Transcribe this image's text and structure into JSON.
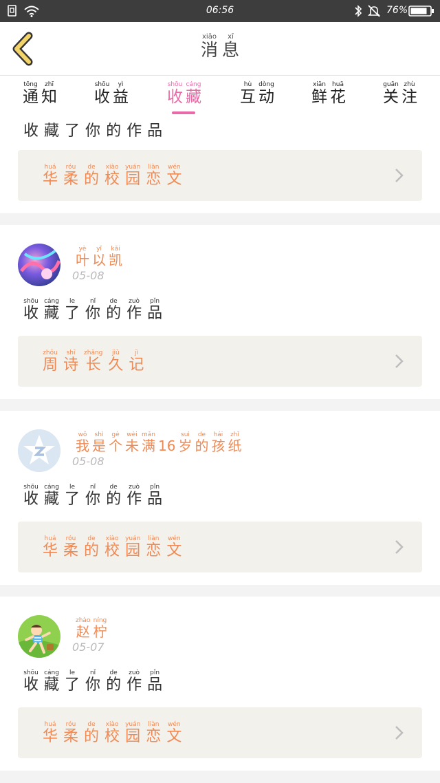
{
  "status_bar": {
    "time": "06:56",
    "battery_percent": "76%"
  },
  "header": {
    "title": [
      {
        "c": "消",
        "p": "xiāo"
      },
      {
        "c": "息",
        "p": "xī"
      }
    ]
  },
  "tabs": [
    {
      "label": [
        {
          "c": "通",
          "p": "tōng"
        },
        {
          "c": "知",
          "p": "zhī"
        }
      ]
    },
    {
      "label": [
        {
          "c": "收",
          "p": "shōu"
        },
        {
          "c": "益",
          "p": "yì"
        }
      ]
    },
    {
      "label": [
        {
          "c": "收",
          "p": "shōu"
        },
        {
          "c": "藏",
          "p": "cáng"
        }
      ],
      "active": true
    },
    {
      "label": [
        {
          "c": "互",
          "p": "hù"
        },
        {
          "c": "动",
          "p": "dòng"
        }
      ]
    },
    {
      "label": [
        {
          "c": "鲜",
          "p": "xiān"
        },
        {
          "c": "花",
          "p": "huā"
        }
      ]
    },
    {
      "label": [
        {
          "c": "关",
          "p": "guān"
        },
        {
          "c": "注",
          "p": "zhù"
        }
      ]
    }
  ],
  "cards": [
    {
      "user": "",
      "date": "",
      "action": [
        {
          "c": "收"
        },
        {
          "c": "藏"
        },
        {
          "c": "了"
        },
        {
          "c": "你"
        },
        {
          "c": "的"
        },
        {
          "c": "作"
        },
        {
          "c": "品"
        }
      ],
      "work": [
        {
          "c": "华",
          "p": "huá"
        },
        {
          "c": "柔",
          "p": "róu"
        },
        {
          "c": "的",
          "p": "de"
        },
        {
          "c": "校",
          "p": "xiào"
        },
        {
          "c": "园",
          "p": "yuán"
        },
        {
          "c": "恋",
          "p": "liàn"
        },
        {
          "c": "文",
          "p": "wén"
        }
      ]
    },
    {
      "user": [
        {
          "c": "叶",
          "p": "yè"
        },
        {
          "c": "以",
          "p": "yǐ"
        },
        {
          "c": "凯",
          "p": "kǎi"
        }
      ],
      "date": "05-08",
      "avatar": "colorful-abstract",
      "action": [
        {
          "c": "收",
          "p": "shōu"
        },
        {
          "c": "藏",
          "p": "cáng"
        },
        {
          "c": "了",
          "p": "le"
        },
        {
          "c": "你",
          "p": "nǐ"
        },
        {
          "c": "的",
          "p": "de"
        },
        {
          "c": "作",
          "p": "zuò"
        },
        {
          "c": "品",
          "p": "pǐn"
        }
      ],
      "work": [
        {
          "c": "周",
          "p": "zhōu"
        },
        {
          "c": "诗",
          "p": "shī"
        },
        {
          "c": "长",
          "p": "zhǎng"
        },
        {
          "c": "久",
          "p": "jiǔ"
        },
        {
          "c": "记",
          "p": "jì"
        }
      ]
    },
    {
      "user": [
        {
          "c": "我",
          "p": "wǒ"
        },
        {
          "c": "是",
          "p": "shì"
        },
        {
          "c": "个",
          "p": "gè"
        },
        {
          "c": "未",
          "p": "wèi"
        },
        {
          "c": "满",
          "p": "mǎn"
        },
        {
          "c": "16",
          "p": ""
        },
        {
          "c": "岁",
          "p": "suì"
        },
        {
          "c": "的",
          "p": "de"
        },
        {
          "c": "孩",
          "p": "hái"
        },
        {
          "c": "纸",
          "p": "zhǐ"
        }
      ],
      "date": "05-08",
      "avatar": "default-star",
      "action": [
        {
          "c": "收",
          "p": "shōu"
        },
        {
          "c": "藏",
          "p": "cáng"
        },
        {
          "c": "了",
          "p": "le"
        },
        {
          "c": "你",
          "p": "nǐ"
        },
        {
          "c": "的",
          "p": "de"
        },
        {
          "c": "作",
          "p": "zuò"
        },
        {
          "c": "品",
          "p": "pǐn"
        }
      ],
      "work": [
        {
          "c": "华",
          "p": "huá"
        },
        {
          "c": "柔",
          "p": "róu"
        },
        {
          "c": "的",
          "p": "de"
        },
        {
          "c": "校",
          "p": "xiào"
        },
        {
          "c": "园",
          "p": "yuán"
        },
        {
          "c": "恋",
          "p": "liàn"
        },
        {
          "c": "文",
          "p": "wén"
        }
      ]
    },
    {
      "user": [
        {
          "c": "赵",
          "p": "zhào"
        },
        {
          "c": "柠",
          "p": "níng"
        }
      ],
      "date": "05-07",
      "avatar": "child-on-grass",
      "action": [
        {
          "c": "收",
          "p": "shōu"
        },
        {
          "c": "藏",
          "p": "cáng"
        },
        {
          "c": "了",
          "p": "le"
        },
        {
          "c": "你",
          "p": "nǐ"
        },
        {
          "c": "的",
          "p": "de"
        },
        {
          "c": "作",
          "p": "zuò"
        },
        {
          "c": "品",
          "p": "pǐn"
        }
      ],
      "work": [
        {
          "c": "华",
          "p": "huá"
        },
        {
          "c": "柔",
          "p": "róu"
        },
        {
          "c": "的",
          "p": "de"
        },
        {
          "c": "校",
          "p": "xiào"
        },
        {
          "c": "园",
          "p": "yuán"
        },
        {
          "c": "恋",
          "p": "liàn"
        },
        {
          "c": "文",
          "p": "wén"
        }
      ]
    }
  ],
  "colors": {
    "accent_pink": "#e86aa7",
    "orange_text": "#f08a55",
    "back_arrow_yellow": "#f3d46a",
    "statusbar": "#3d3d3d"
  }
}
